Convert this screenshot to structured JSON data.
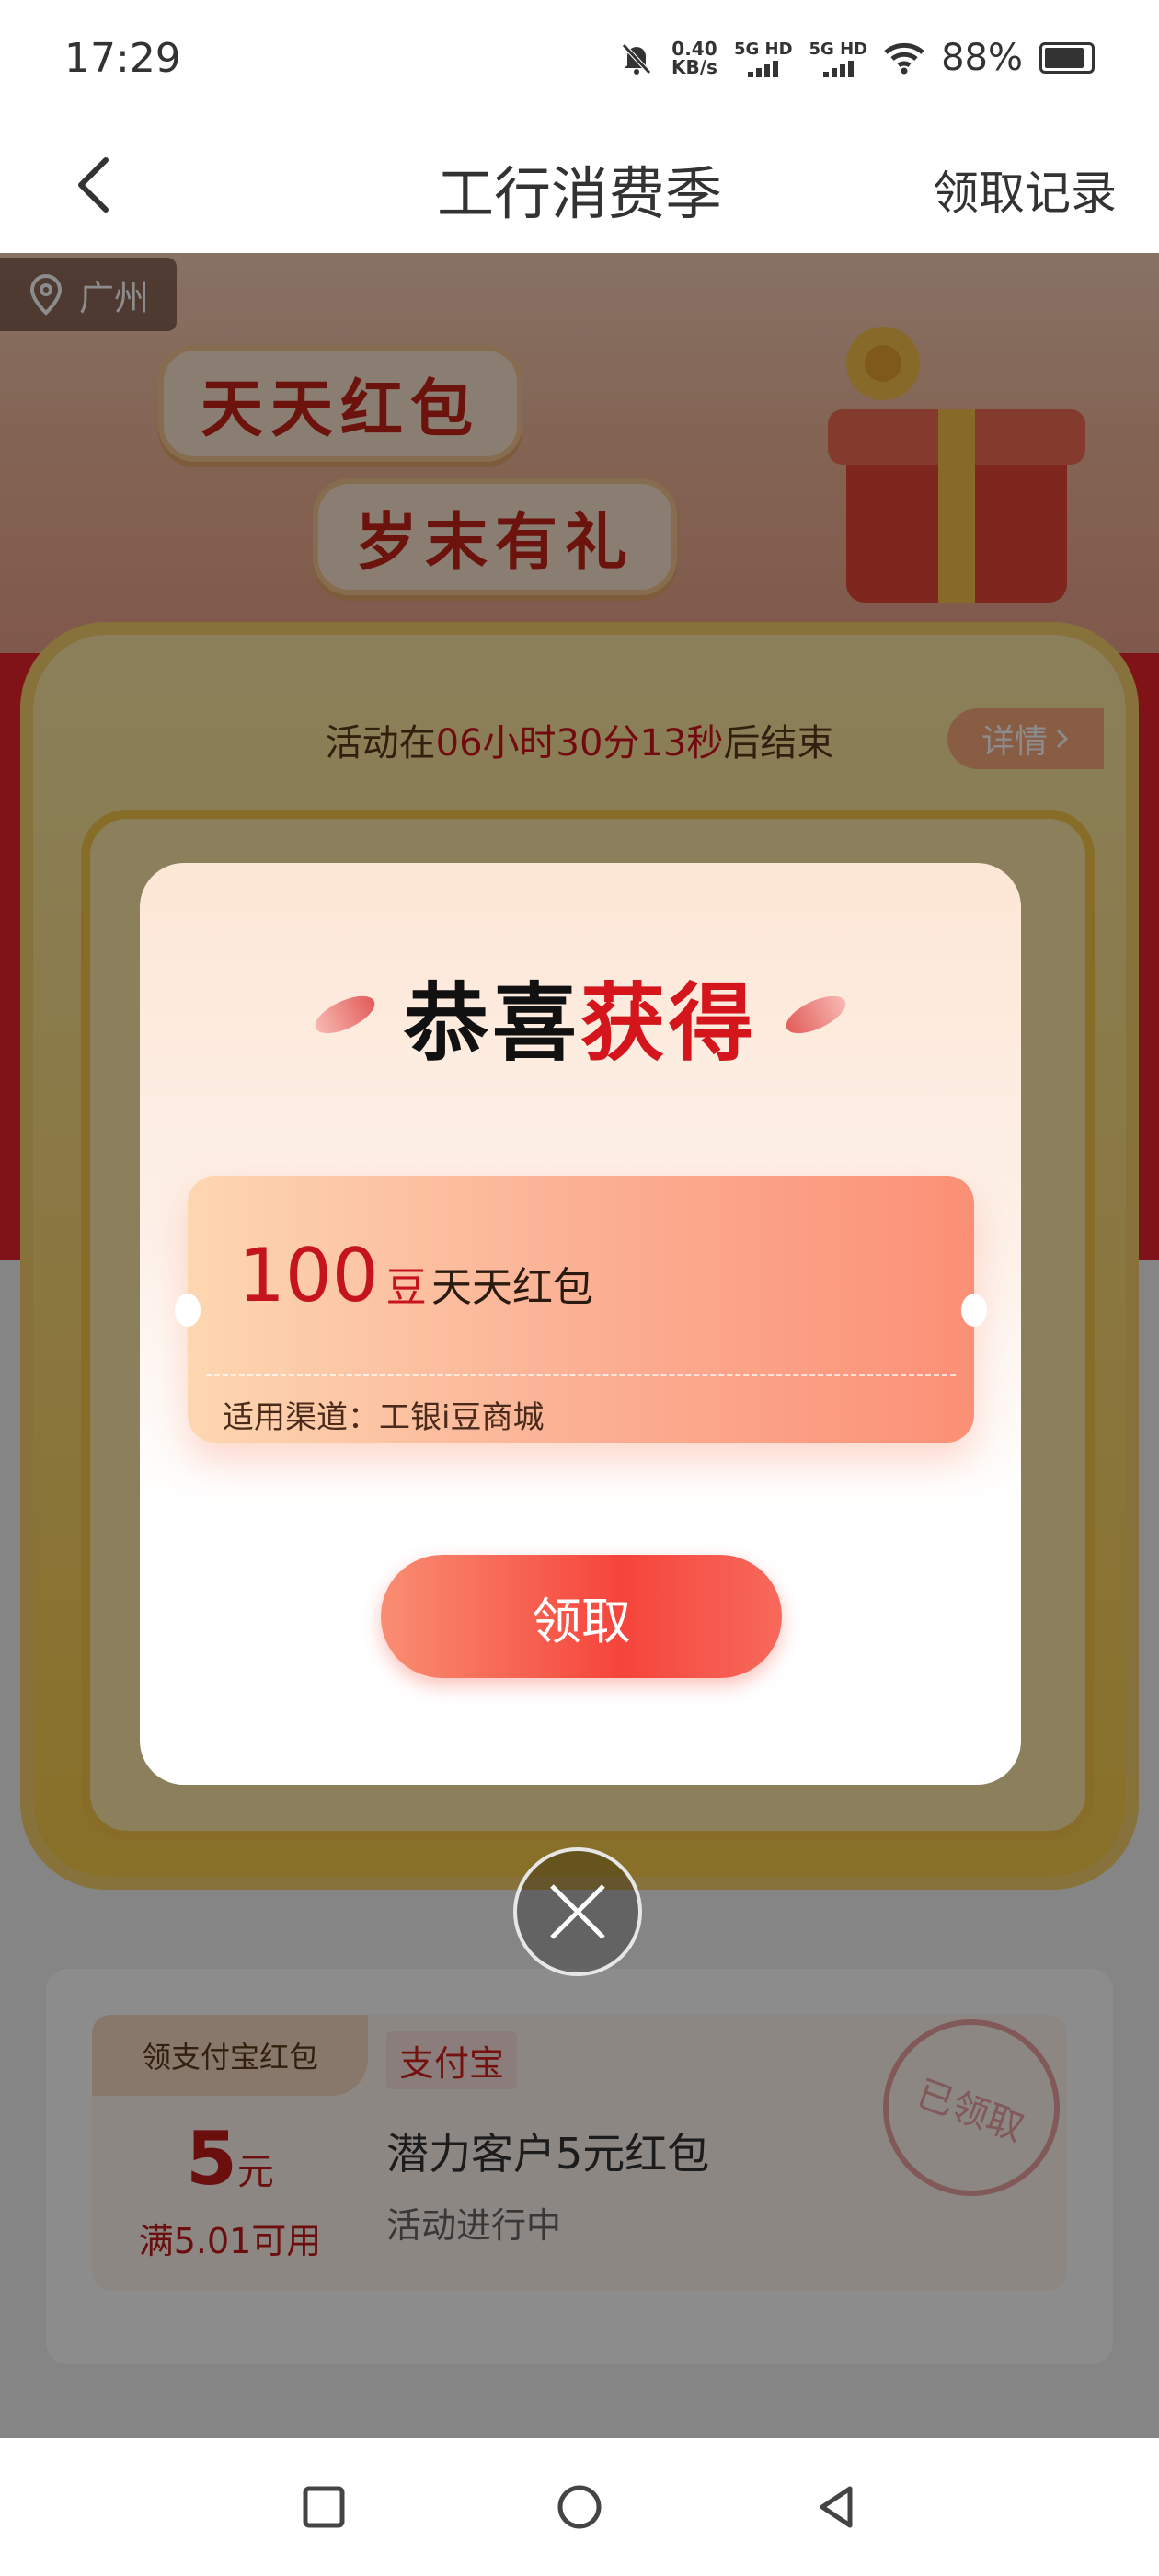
{
  "status_bar": {
    "time": "17:29",
    "net_speed_value": "0.40",
    "net_speed_unit": "KB/s",
    "sim1_label": "5G HD",
    "sim2_label": "5G HD",
    "battery": "88%"
  },
  "nav": {
    "title": "工行消费季",
    "records": "领取记录"
  },
  "banner": {
    "location": "广州",
    "badge1": "天天红包",
    "badge2": "岁末有礼"
  },
  "countdown": {
    "prefix": "活动在",
    "hours": "06小时",
    "minutes": "30分",
    "seconds": "13秒",
    "suffix": "后结束",
    "details": "详情"
  },
  "modal": {
    "title_black": "恭喜",
    "title_red": "获得",
    "prize_value": "100",
    "prize_unit": "豆",
    "prize_name": "天天红包",
    "prize_channel": "适用渠道：工银i豆商城",
    "claim": "领取"
  },
  "coupon": {
    "tag": "领支付宝红包",
    "amount": "5",
    "amount_unit": "元",
    "condition": "满5.01可用",
    "platform": "支付宝",
    "name": "潜力客户5元红包",
    "status": "活动进行中",
    "stamp": "已领取"
  },
  "colors": {
    "accent_red": "#d4161c",
    "gold": "#f9cc4a",
    "claim_button": "#f5443b"
  }
}
